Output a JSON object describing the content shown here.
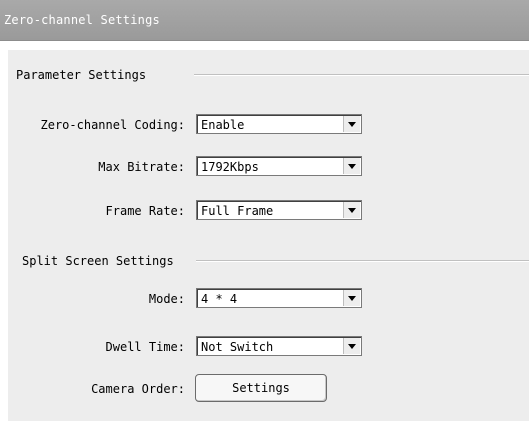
{
  "title": "Zero-channel Settings",
  "parameter_group": {
    "title": "Parameter Settings",
    "zero_channel_coding": {
      "label": "Zero-channel Coding:",
      "value": "Enable"
    },
    "max_bitrate": {
      "label": "Max Bitrate:",
      "value": "1792Kbps"
    },
    "frame_rate": {
      "label": "Frame Rate:",
      "value": "Full Frame"
    }
  },
  "split_group": {
    "title": "Split Screen Settings",
    "mode": {
      "label": "Mode:",
      "value": "4 * 4"
    },
    "dwell_time": {
      "label": "Dwell Time:",
      "value": "Not Switch"
    },
    "camera_order": {
      "label": "Camera Order:",
      "button_label": "Settings"
    }
  }
}
